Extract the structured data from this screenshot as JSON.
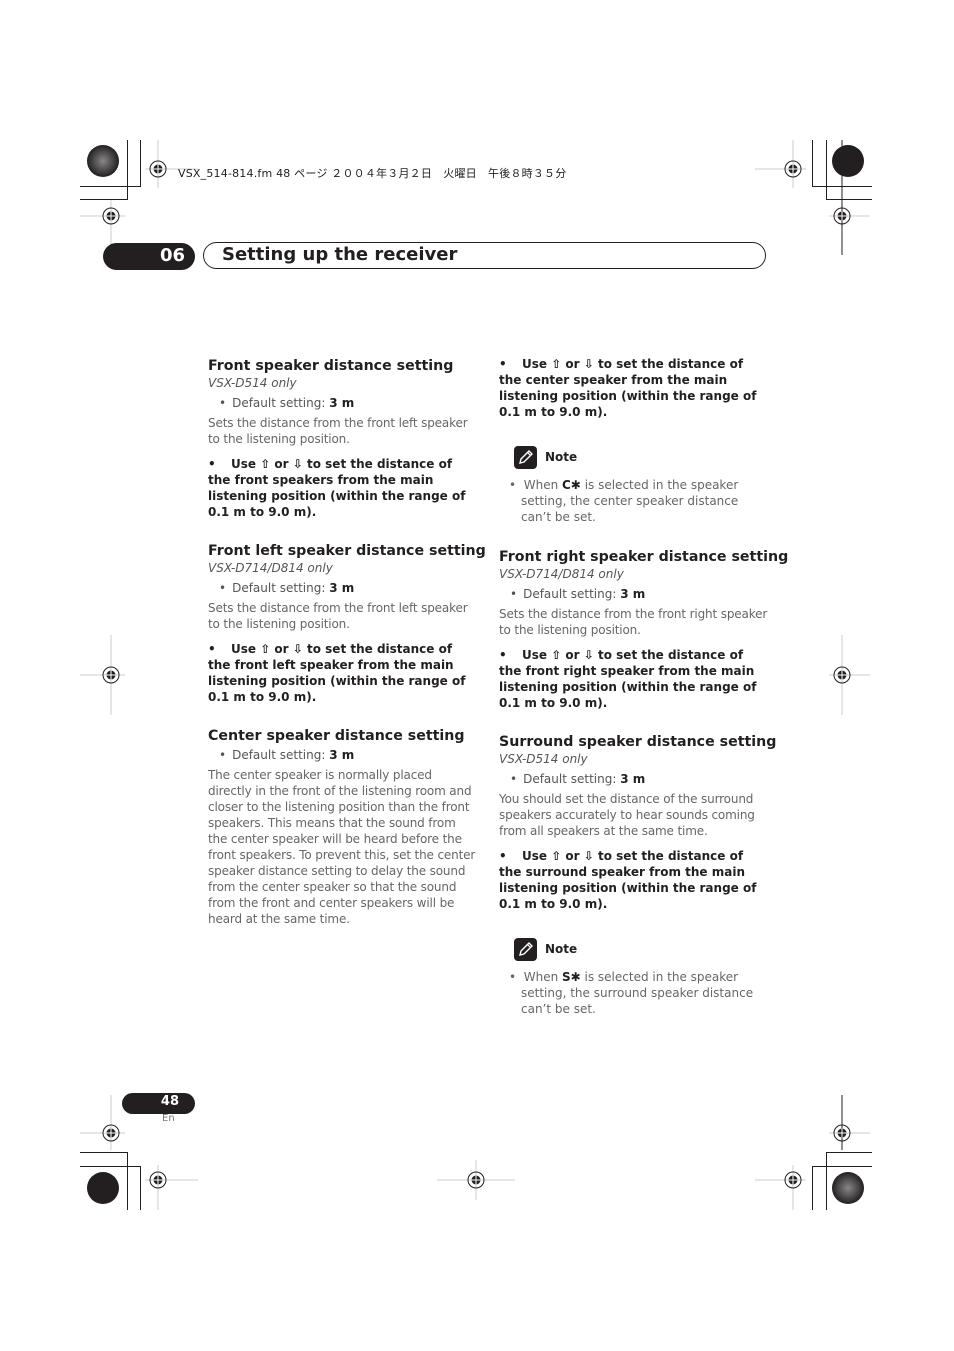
{
  "print_header": "VSX_514-814.fm  48 ページ  ２００４年３月２日　火曜日　午後８時３５分",
  "chapter": {
    "number": "06",
    "title": "Setting up the receiver"
  },
  "left_column": [
    {
      "title": "Front speaker distance setting",
      "model": "VSX-D514 only",
      "default_label": "Default setting: ",
      "default_value": "3 m",
      "description": "Sets the distance from the front left speaker to the listening position.",
      "instruction": "Use ⇧ or ⇩ to set the distance of the front speakers from the main listening position (within the range of 0.1 m to 9.0 m)."
    },
    {
      "title": "Front left speaker distance setting",
      "model": "VSX-D714/D814 only",
      "default_label": "Default setting: ",
      "default_value": "3 m",
      "description": "Sets the distance from the front left speaker to the listening position.",
      "instruction": "Use ⇧ or ⇩ to set the distance of the front left speaker from the main listening position (within the range of 0.1 m to 9.0 m)."
    },
    {
      "title": "Center speaker distance setting",
      "default_label": "Default setting: ",
      "default_value": "3 m",
      "description": "The center speaker is normally placed directly in the front of the listening room and closer to the listening position than the front speakers. This means that the sound from the center speaker will be heard before the front speakers. To prevent this, set the center speaker distance setting to delay the sound from the center speaker so that the sound from the front and center speakers will be heard at the same time."
    }
  ],
  "right_column": {
    "center_instruction": "Use ⇧ or ⇩ to set the distance of the center speaker from the main listening position (within the range of 0.1 m to 9.0 m).",
    "note1": {
      "label": "Note",
      "prefix": "When ",
      "symbol": "C✱",
      "text": " is selected in the speaker setting, the center speaker distance can’t be set."
    },
    "sections": [
      {
        "title": "Front right speaker distance setting",
        "model": "VSX-D714/D814 only",
        "default_label": "Default setting: ",
        "default_value": "3 m",
        "description": "Sets the distance from the front right speaker to the listening position.",
        "instruction": "Use ⇧ or ⇩ to set the distance of the front right speaker from the main listening position (within the range of 0.1 m to 9.0 m)."
      },
      {
        "title": "Surround speaker distance setting",
        "model": "VSX-D514 only",
        "default_label": "Default setting: ",
        "default_value": "3 m",
        "description": "You should set the distance of the surround speakers accurately to hear sounds coming from all speakers at the same time.",
        "instruction": "Use ⇧ or ⇩ to set the distance of the surround speaker from the main listening position (within the range of 0.1 m to 9.0 m)."
      }
    ],
    "note2": {
      "label": "Note",
      "prefix": "When ",
      "symbol": "S✱",
      "text": " is selected in the speaker setting, the surround speaker distance can’t be set."
    }
  },
  "footer": {
    "page_number": "48",
    "language": "En"
  },
  "bullet": "•"
}
